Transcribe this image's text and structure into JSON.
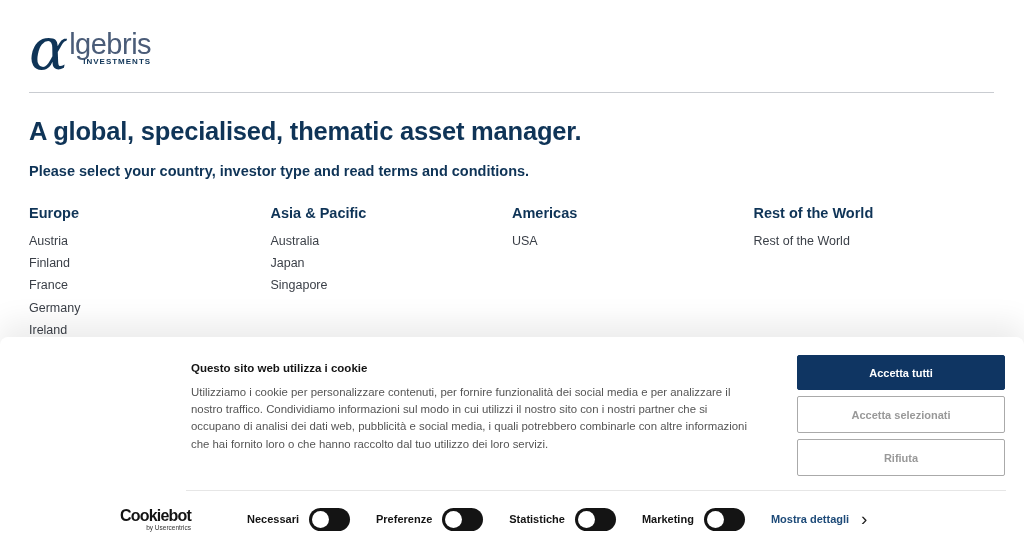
{
  "logo": {
    "mark": "α",
    "name": "lgebris",
    "tagline": "INVESTMENTS"
  },
  "headline": "A global, specialised, thematic asset manager.",
  "subheadline": "Please select your country, investor type and read terms and conditions.",
  "regions": [
    {
      "title": "Europe",
      "countries": [
        "Austria",
        "Finland",
        "France",
        "Germany",
        "Ireland"
      ]
    },
    {
      "title": "Asia & Pacific",
      "countries": [
        "Australia",
        "Japan",
        "Singapore"
      ]
    },
    {
      "title": "Americas",
      "countries": [
        "USA"
      ]
    },
    {
      "title": "Rest of the World",
      "countries": [
        "Rest of the World"
      ]
    }
  ],
  "cookie_banner": {
    "title": "Questo sito web utilizza i cookie",
    "text": "Utilizziamo i cookie per personalizzare contenuti, per fornire funzionalità dei social media e per analizzare il nostro traffico. Condividiamo informazioni sul modo in cui utilizzi il nostro sito con i nostri partner che si occupano di analisi dei dati web, pubblicità e social media, i quali potrebbero combinarle con altre informazioni che hai fornito loro o che hanno raccolto dal tuo utilizzo dei loro servizi.",
    "buttons": [
      {
        "label": "Accetta tutti",
        "kind": "primary"
      },
      {
        "label": "Accetta selezionati",
        "kind": "outline"
      },
      {
        "label": "Rifiuta",
        "kind": "outline"
      }
    ],
    "brand": {
      "name": "Cookiebot",
      "byline": "by Usercentrics"
    },
    "toggles": [
      {
        "label": "Necessari",
        "on": false
      },
      {
        "label": "Preferenze",
        "on": false
      },
      {
        "label": "Statistiche",
        "on": false
      },
      {
        "label": "Marketing",
        "on": false
      }
    ],
    "details_link": "Mostra dettagli",
    "details_arrow": "›"
  }
}
